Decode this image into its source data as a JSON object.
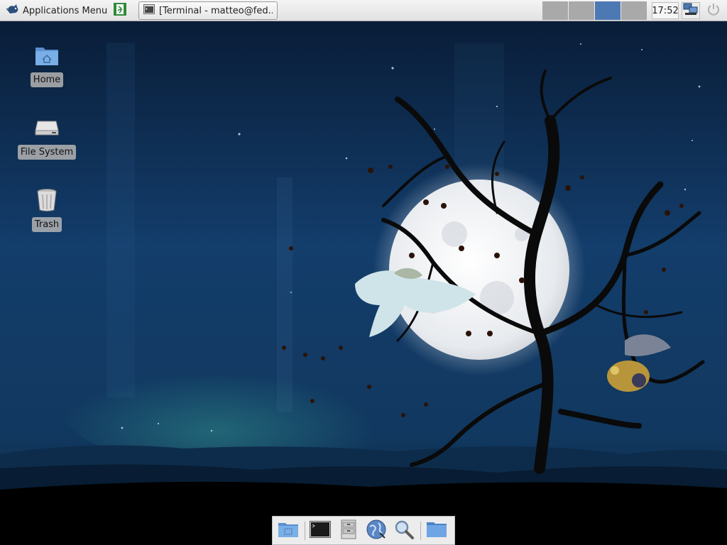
{
  "panel": {
    "apps_menu_label": "Applications Menu",
    "task_button_label": "[Terminal - matteo@fed...",
    "workspaces": [
      {
        "label": "Workspace 1",
        "active": false
      },
      {
        "label": "Workspace 2",
        "active": false
      },
      {
        "label": "Workspace 3",
        "active": true
      },
      {
        "label": "Workspace 4",
        "active": false
      }
    ],
    "clock": "17:52"
  },
  "desktop": {
    "icons": [
      {
        "label": "Home",
        "icon": "home-folder-icon"
      },
      {
        "label": "File System",
        "icon": "drive-icon"
      },
      {
        "label": "Trash",
        "icon": "trash-icon"
      }
    ]
  },
  "dock": {
    "items": [
      {
        "icon": "show-desktop-icon"
      },
      {
        "icon": "terminal-icon"
      },
      {
        "icon": "file-manager-icon"
      },
      {
        "icon": "web-browser-icon"
      },
      {
        "icon": "search-icon"
      },
      {
        "icon": "folder-icon"
      }
    ]
  },
  "colors": {
    "sky_top": "#0a1c36",
    "sky_mid": "#123a66",
    "workspace_active": "#4c79b4",
    "workspace_inactive": "#a9a9a9",
    "moon": "#f2f4f6"
  }
}
